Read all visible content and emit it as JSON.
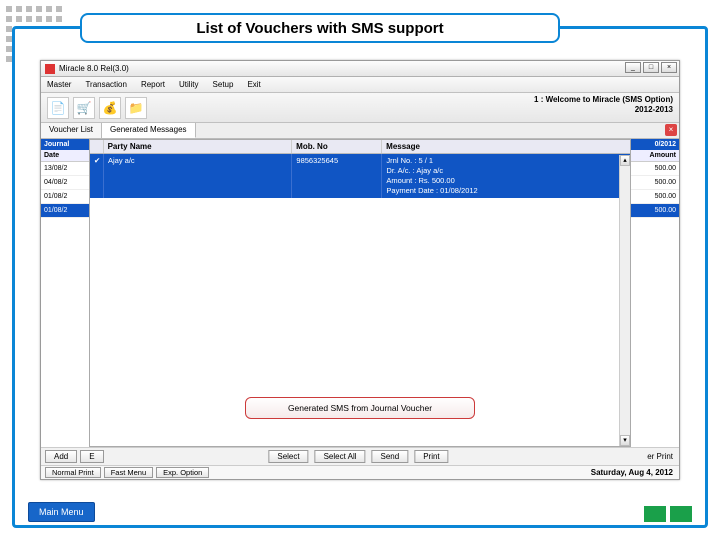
{
  "slide_title": "List of Vouchers with SMS support",
  "app": {
    "title": "Miracle 8.0 Rel(3.0)",
    "win_buttons": {
      "min": "_",
      "max": "□",
      "close": "×"
    },
    "menubar": [
      "Master",
      "Transaction",
      "Report",
      "Utility",
      "Setup",
      "Exit"
    ],
    "toolbar_icons": [
      "doc-icon",
      "cart-icon",
      "bag-icon",
      "folder-icon"
    ],
    "welcome_line1": "1 : Welcome to Miracle (SMS Option)",
    "welcome_line2": "2012-2013",
    "tabs": {
      "back": "Voucher List",
      "front": "Generated Messages"
    }
  },
  "voucher_bg": {
    "left_header": "Journal",
    "left_sub": "Date",
    "left_rows": [
      "13/08/2",
      "04/08/2",
      "01/08/2",
      "01/08/2"
    ],
    "right_header": "0/2012",
    "right_sub": "Amount",
    "right_rows": [
      "500.00",
      "500.00",
      "500.00",
      "500.00"
    ]
  },
  "messages": {
    "columns": {
      "chk": "",
      "party": "Party Name",
      "mob": "Mob. No",
      "msg": "Message"
    },
    "row": {
      "chk": "✔",
      "party": "Ajay a/c",
      "mob": "9856325645",
      "msg_lines": [
        "Jrnl No. : 5 / 1",
        "Dr. A/c. : Ajay a/c",
        "Amount : Rs. 500.00",
        "Payment Date : 01/08/2012"
      ]
    }
  },
  "callout": "Generated SMS from Journal Voucher",
  "btn_row1": {
    "left": [
      "Add",
      "E"
    ],
    "center": [
      "Select",
      "Select All",
      "Send",
      "Print"
    ],
    "right": "er Print"
  },
  "btn_row2": {
    "left": [
      "Normal Print",
      "Fast Menu",
      "Exp. Option"
    ],
    "date": "Saturday, Aug 4, 2012"
  },
  "main_menu": "Main Menu"
}
